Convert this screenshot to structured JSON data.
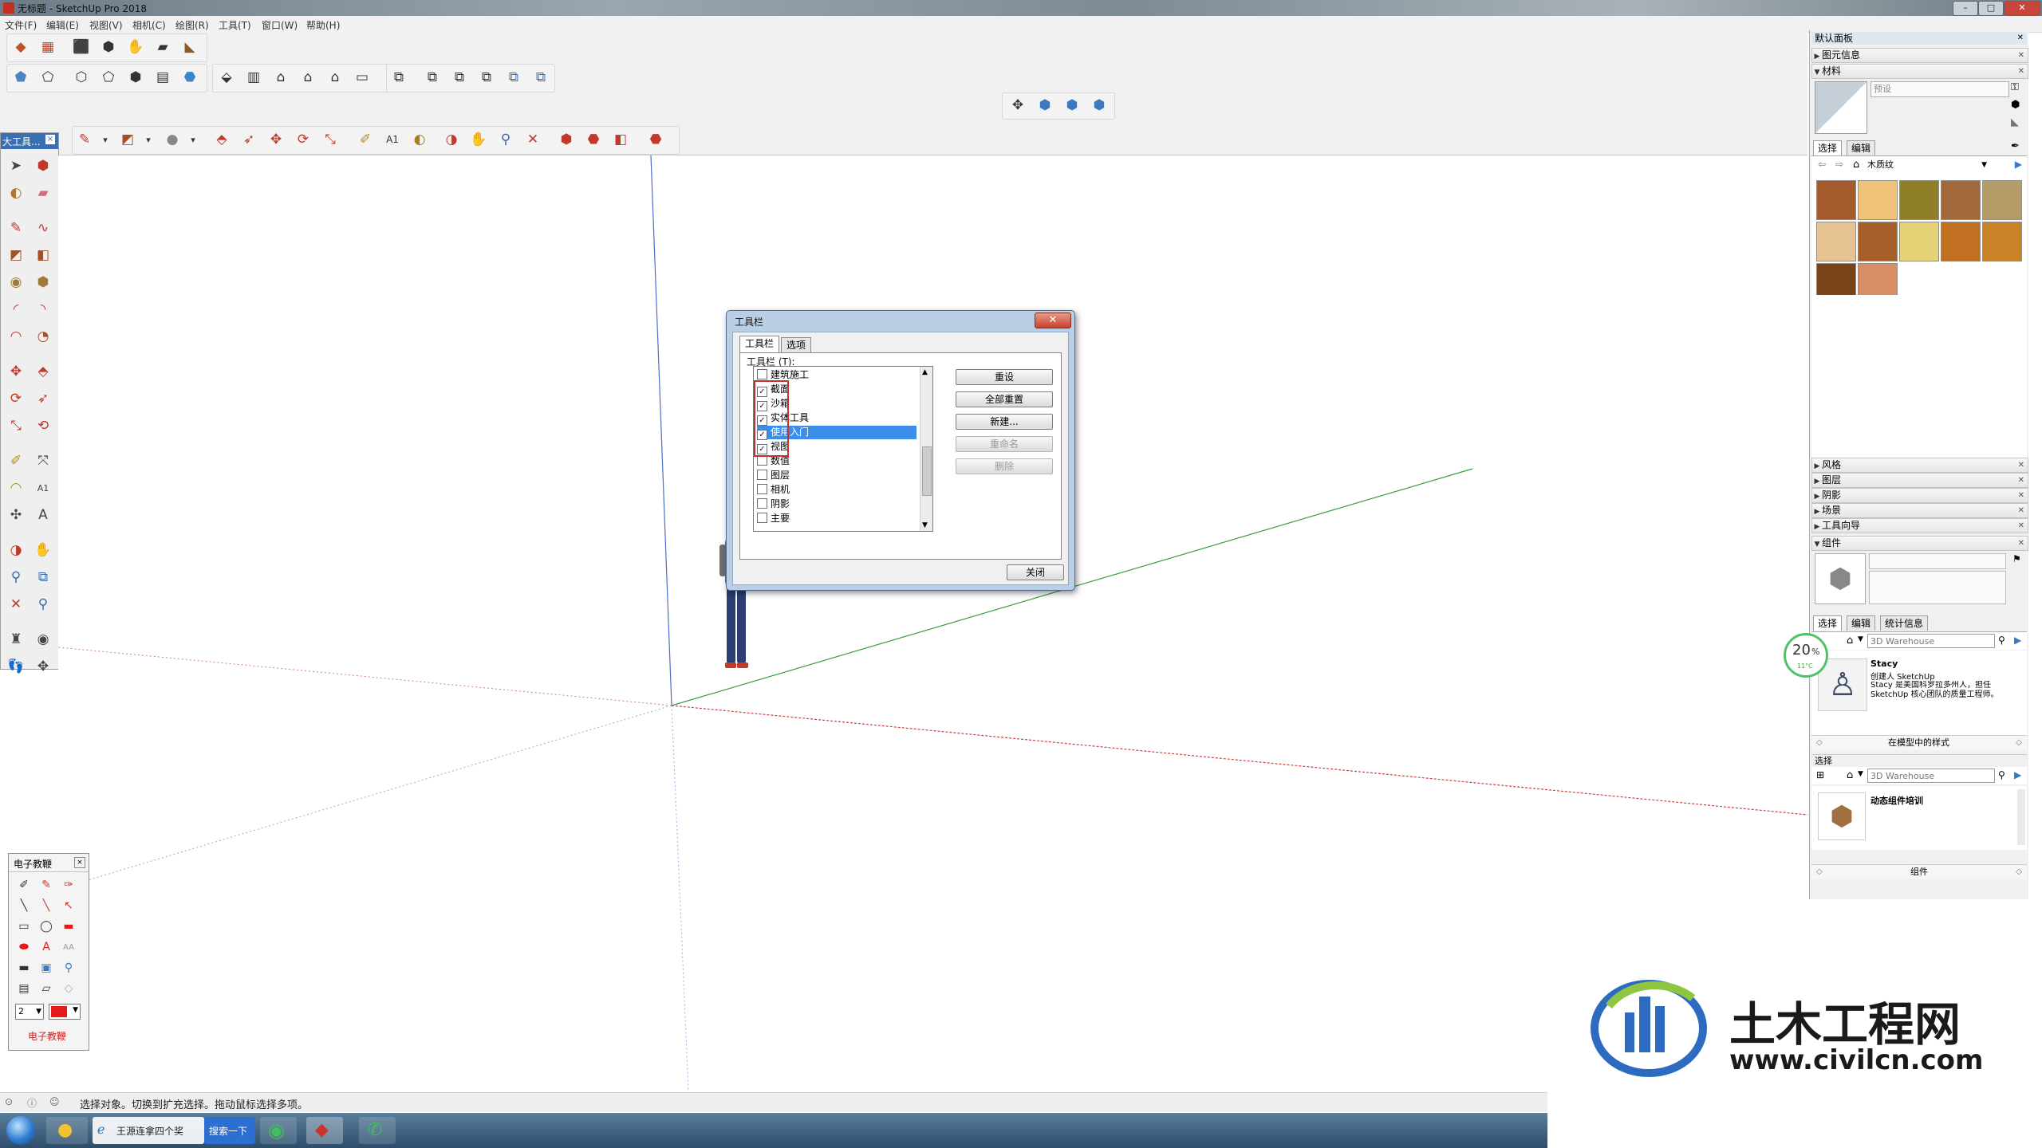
{
  "window": {
    "title": "无标题 - SketchUp Pro 2018",
    "min": "–",
    "max": "□",
    "close": "✕"
  },
  "menu": [
    "文件(F)",
    "编辑(E)",
    "视图(V)",
    "相机(C)",
    "绘图(R)",
    "工具(T)",
    "窗口(W)",
    "帮助(H)"
  ],
  "left_palette": {
    "title": "大工具..."
  },
  "epen": {
    "title": "电子教鞭",
    "size_value": "2",
    "footer": "电子教鞭",
    "pen_color": "#e31b1b"
  },
  "dialog": {
    "title": "工具栏",
    "close_x": "✕",
    "tabs": [
      "工具栏",
      "选项"
    ],
    "list_label": "工具栏 (T):",
    "items": [
      {
        "label": "建筑施工",
        "checked": false,
        "selected": false
      },
      {
        "label": "截面",
        "checked": true,
        "selected": false
      },
      {
        "label": "沙箱",
        "checked": true,
        "selected": false
      },
      {
        "label": "实体工具",
        "checked": true,
        "selected": false
      },
      {
        "label": "使用入门",
        "checked": true,
        "selected": true
      },
      {
        "label": "视图",
        "checked": true,
        "selected": false
      },
      {
        "label": "数值",
        "checked": false,
        "selected": false
      },
      {
        "label": "图层",
        "checked": false,
        "selected": false
      },
      {
        "label": "相机",
        "checked": false,
        "selected": false
      },
      {
        "label": "阴影",
        "checked": false,
        "selected": false
      },
      {
        "label": "主要",
        "checked": false,
        "selected": false
      }
    ],
    "buttons": {
      "reset": "重设",
      "reset_all": "全部重置",
      "new": "新建...",
      "rename": "重命名",
      "delete": "删除",
      "close": "关闭"
    }
  },
  "tray": {
    "title": "默认面板",
    "entity_info": "图元信息",
    "materials": "材料",
    "preset_placeholder": "预设",
    "tab_select": "选择",
    "tab_edit": "编辑",
    "material_collection": "木质纹",
    "swatches": [
      "#a45a2a",
      "#f0c27a",
      "#8f7f26",
      "#a1683a",
      "#b49d69",
      "#e5c393",
      "#a8602a",
      "#e5d276",
      "#c07020",
      "#c98326",
      "#7a4418",
      "#d88e64"
    ],
    "collapsed": [
      "风格",
      "图层",
      "阴影",
      "场景",
      "工具向导"
    ],
    "components": "组件",
    "comp_tabs": [
      "选择",
      "编辑",
      "统计信息"
    ],
    "warehouse_placeholder": "3D Warehouse",
    "comp_name": "Stacy",
    "comp_author": "创建人 SketchUp",
    "comp_desc": "Stacy 是美国科罗拉多州人，担任 SketchUp 核心团队的质量工程师。",
    "in_model": "在模型中的样式",
    "select_label": "选择",
    "result_title": "动态组件培训",
    "comp_footer": "组件"
  },
  "badge": {
    "percent": "20",
    "unit": "%",
    "temp": "11°C"
  },
  "status": {
    "text": "选择对象。切换到扩充选择。拖动鼠标选择多项。"
  },
  "taskbar": {
    "ie_label": "王源连拿四个奖",
    "search_btn": "搜索一下"
  },
  "watermark": {
    "cn": "土木工程网",
    "url": "www.civilcn.com"
  },
  "icons": {
    "select": "arrow-icon",
    "eraser": "eraser-icon",
    "pencil": "pencil-icon",
    "orbit": "orbit-icon",
    "zoom": "zoom-icon"
  },
  "colors": {
    "axis_red": "#d04040",
    "axis_green": "#3a9e3a",
    "axis_blue": "#4a6ec8",
    "selection": "#3d8ee9",
    "highlight_box": "#c0322c"
  }
}
